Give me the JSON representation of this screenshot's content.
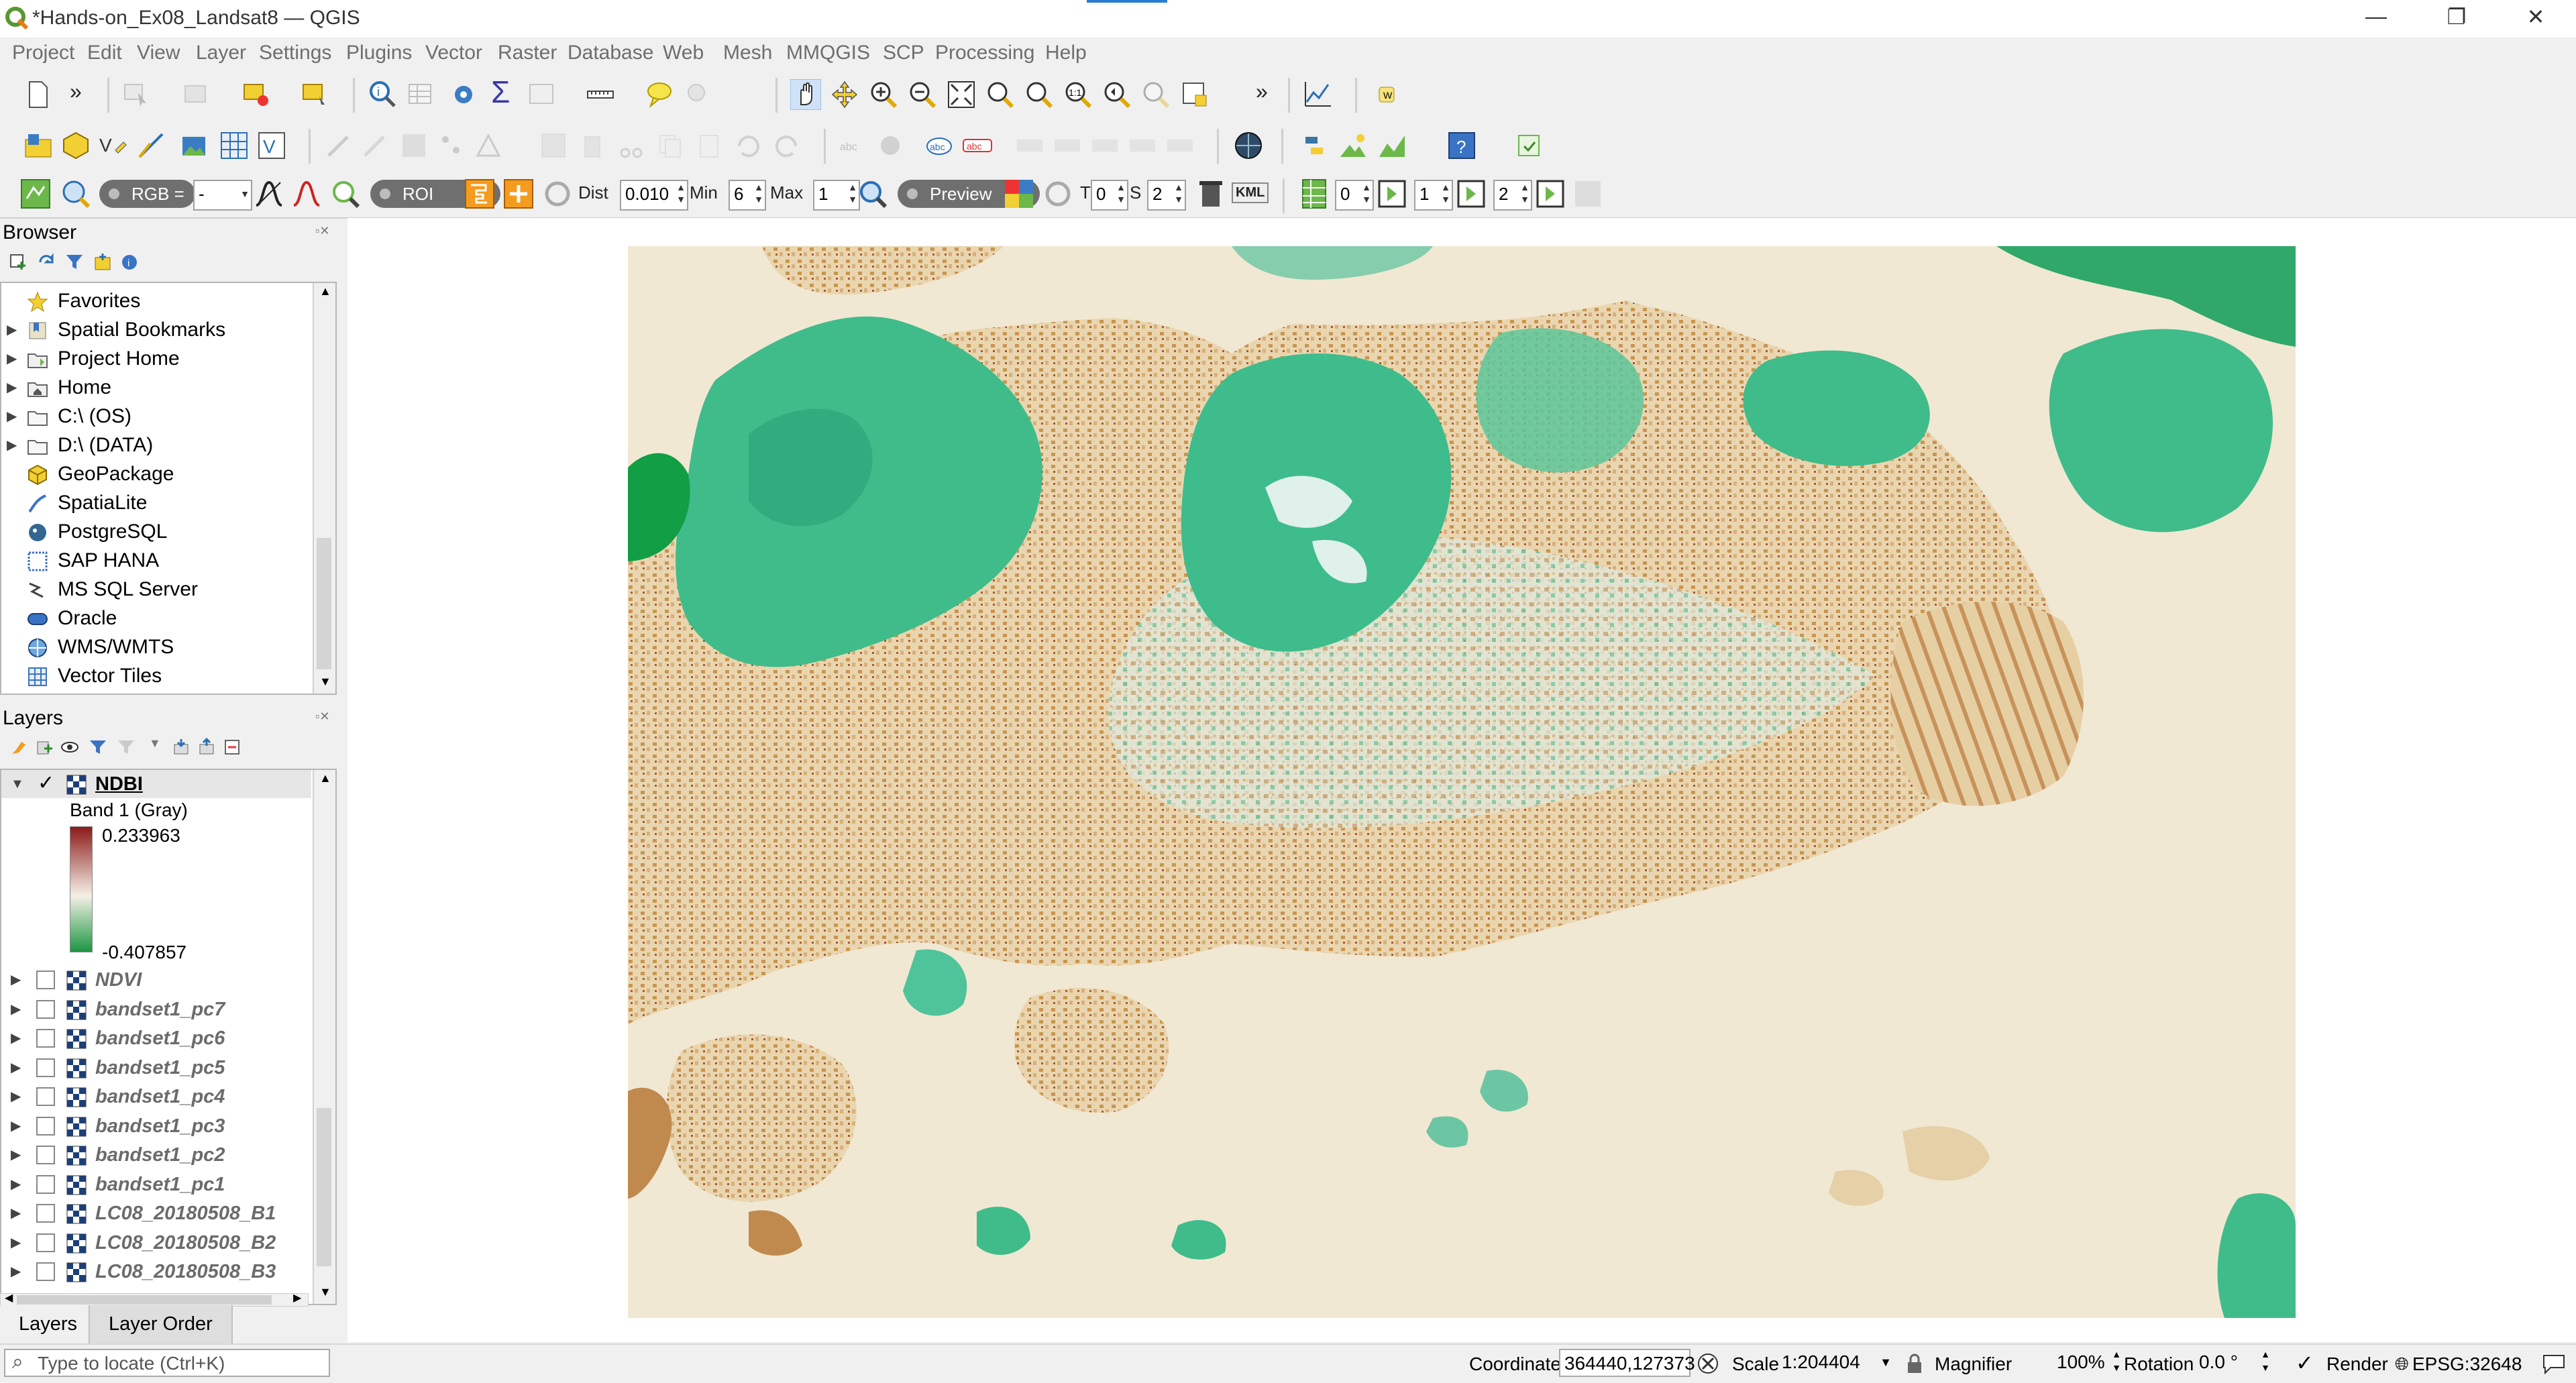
{
  "window": {
    "title": "*Hands-on_Ex08_Landsat8 — QGIS",
    "minimize": "—",
    "restore": "❐",
    "close": "✕"
  },
  "menu": [
    "Project",
    "Edit",
    "View",
    "Layer",
    "Settings",
    "Plugins",
    "Vector",
    "Raster",
    "Database",
    "Web",
    "Mesh",
    "MMQGIS",
    "SCP",
    "Processing",
    "Help"
  ],
  "scp_toolbar": {
    "rgb_label": "RGB =",
    "rgb_value": "-",
    "roi_label": "ROI",
    "dist_label": "Dist",
    "dist_value": "0.010",
    "min_label": "Min",
    "min_value": "6",
    "max_label": "Max",
    "max_value": "1",
    "preview_label": "Preview",
    "t_label": "T",
    "t_value": "0",
    "s_label": "S",
    "s_value": "2",
    "kml_label": "KML",
    "band_a": "0",
    "band_b": "1",
    "band_c": "2"
  },
  "browser": {
    "title": "Browser",
    "items": [
      {
        "label": "Favorites",
        "icon": "star-icon",
        "expandable": false
      },
      {
        "label": "Spatial Bookmarks",
        "icon": "bookmark-icon",
        "expandable": true
      },
      {
        "label": "Project Home",
        "icon": "folder-icon",
        "expandable": true
      },
      {
        "label": "Home",
        "icon": "home-folder-icon",
        "expandable": true
      },
      {
        "label": "C:\\ (OS)",
        "icon": "drive-icon",
        "expandable": true
      },
      {
        "label": "D:\\ (DATA)",
        "icon": "drive-icon",
        "expandable": true
      },
      {
        "label": "GeoPackage",
        "icon": "geopackage-icon",
        "expandable": false
      },
      {
        "label": "SpatiaLite",
        "icon": "spatialite-icon",
        "expandable": false
      },
      {
        "label": "PostgreSQL",
        "icon": "postgresql-icon",
        "expandable": false
      },
      {
        "label": "SAP HANA",
        "icon": "sap-hana-icon",
        "expandable": false
      },
      {
        "label": "MS SQL Server",
        "icon": "mssql-icon",
        "expandable": false
      },
      {
        "label": "Oracle",
        "icon": "oracle-icon",
        "expandable": false
      },
      {
        "label": "WMS/WMTS",
        "icon": "wms-icon",
        "expandable": false
      },
      {
        "label": "Vector Tiles",
        "icon": "vector-tiles-icon",
        "expandable": false
      }
    ]
  },
  "layers": {
    "title": "Layers",
    "active": {
      "name": "NDBI",
      "checked": true,
      "band": "Band 1 (Gray)",
      "max": "0.233963",
      "min": "-0.407857"
    },
    "items": [
      {
        "name": "NDVI"
      },
      {
        "name": "bandset1_pc7"
      },
      {
        "name": "bandset1_pc6"
      },
      {
        "name": "bandset1_pc5"
      },
      {
        "name": "bandset1_pc4"
      },
      {
        "name": "bandset1_pc3"
      },
      {
        "name": "bandset1_pc2"
      },
      {
        "name": "bandset1_pc1"
      },
      {
        "name": "LC08_20180508_B1"
      },
      {
        "name": "LC08_20180508_B2"
      },
      {
        "name": "LC08_20180508_B3"
      }
    ],
    "tabs": [
      "Layers",
      "Layer Order"
    ]
  },
  "legend_colors": {
    "high": "#8b1a1a",
    "mid": "#f5f0e6",
    "low": "#1a9641"
  },
  "status": {
    "locate_placeholder": "Type to locate (Ctrl+K)",
    "coordinate_label": "Coordinate",
    "coordinate_value": "364440,127373",
    "scale_label": "Scale",
    "scale_value": "1:204404",
    "magnifier_label": "Magnifier",
    "magnifier_value": "100%",
    "rotation_label": "Rotation",
    "rotation_value": "0.0 °",
    "render_label": "Render",
    "render_checked": true,
    "crs": "EPSG:32648"
  }
}
